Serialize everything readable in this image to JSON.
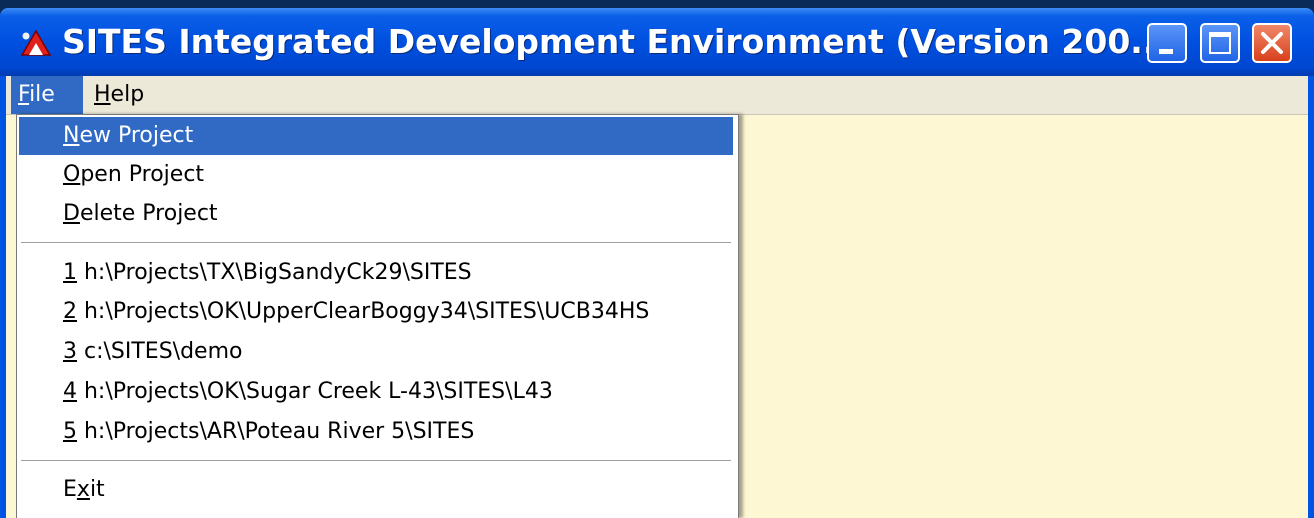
{
  "window": {
    "title": "SITES Integrated Development Environment (Version 200...",
    "controls": {
      "minimize_icon": "minimize-icon",
      "maximize_icon": "maximize-icon",
      "close_icon": "close-icon"
    }
  },
  "menubar": {
    "file": {
      "accel": "F",
      "rest": "ile"
    },
    "help": {
      "accel": "H",
      "rest": "elp"
    }
  },
  "file_menu": {
    "new_project": {
      "accel": "N",
      "rest": "ew Project"
    },
    "open_project": {
      "accel": "O",
      "rest": "pen Project"
    },
    "delete_project": {
      "accel": "D",
      "rest": "elete Project"
    },
    "recent": [
      {
        "num": "1",
        "path": " h:\\Projects\\TX\\BigSandyCk29\\SITES"
      },
      {
        "num": "2",
        "path": " h:\\Projects\\OK\\UpperClearBoggy34\\SITES\\UCB34HS"
      },
      {
        "num": "3",
        "path": " c:\\SITES\\demo"
      },
      {
        "num": "4",
        "path": " h:\\Projects\\OK\\Sugar Creek L-43\\SITES\\L43"
      },
      {
        "num": "5",
        "path": " h:\\Projects\\AR\\Poteau River 5\\SITES"
      }
    ],
    "exit": {
      "pre": "E",
      "accel": "x",
      "rest": "it"
    }
  },
  "colors": {
    "title_bar": "#0054e3",
    "selection": "#316ac5",
    "client_background": "#fdf7d3",
    "menubar": "#ece9d8"
  }
}
